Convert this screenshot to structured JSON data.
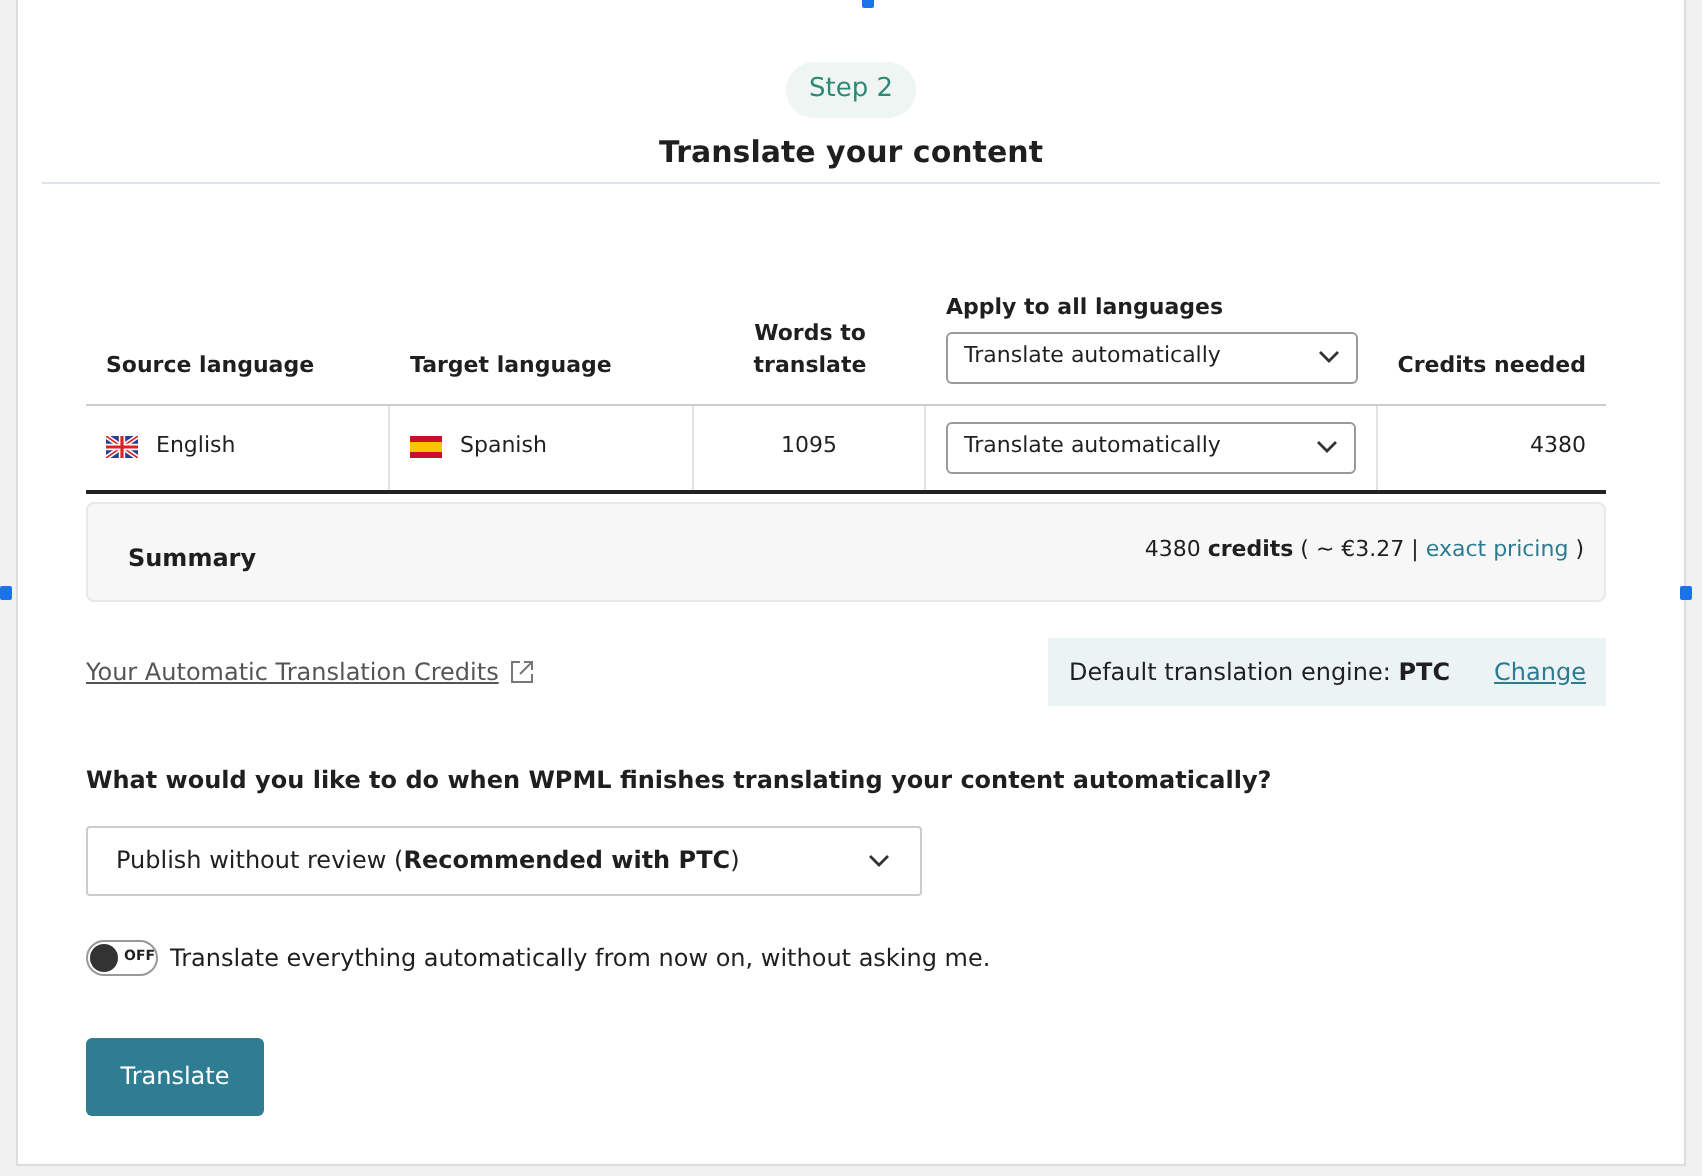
{
  "step": "Step 2",
  "title": "Translate your content",
  "table": {
    "columns": [
      "Source language",
      "Target language",
      "Words to translate",
      "Apply to all languages",
      "Credits needed"
    ],
    "apply_all": {
      "value": "Translate automatically"
    },
    "rows": [
      {
        "languages": [
          {
            "name": "English",
            "kind": "gb"
          },
          {
            "name": "Spanish",
            "kind": "es"
          }
        ],
        "words": "1095",
        "method": "Translate automatically",
        "credits": "4380"
      }
    ]
  },
  "summary": {
    "label": "Summary",
    "text": "4380 **credits** ( ~ €3.27 | ",
    "link": "exact pricing",
    "close": ")"
  },
  "credits_link": "Your Automatic Translation Credits",
  "engine": {
    "text": "Default translation engine: **PTC**",
    "change": "Change"
  },
  "question": "What would you like to do when WPML finishes translating your content automatically?",
  "review_select": {
    "value": "Publish without review (**Recommended with PTC**)"
  },
  "auto_toggle": {
    "on": false,
    "state_label": "OFF",
    "label": "Translate everything automatically from now on, without asking me."
  },
  "button": "Translate"
}
